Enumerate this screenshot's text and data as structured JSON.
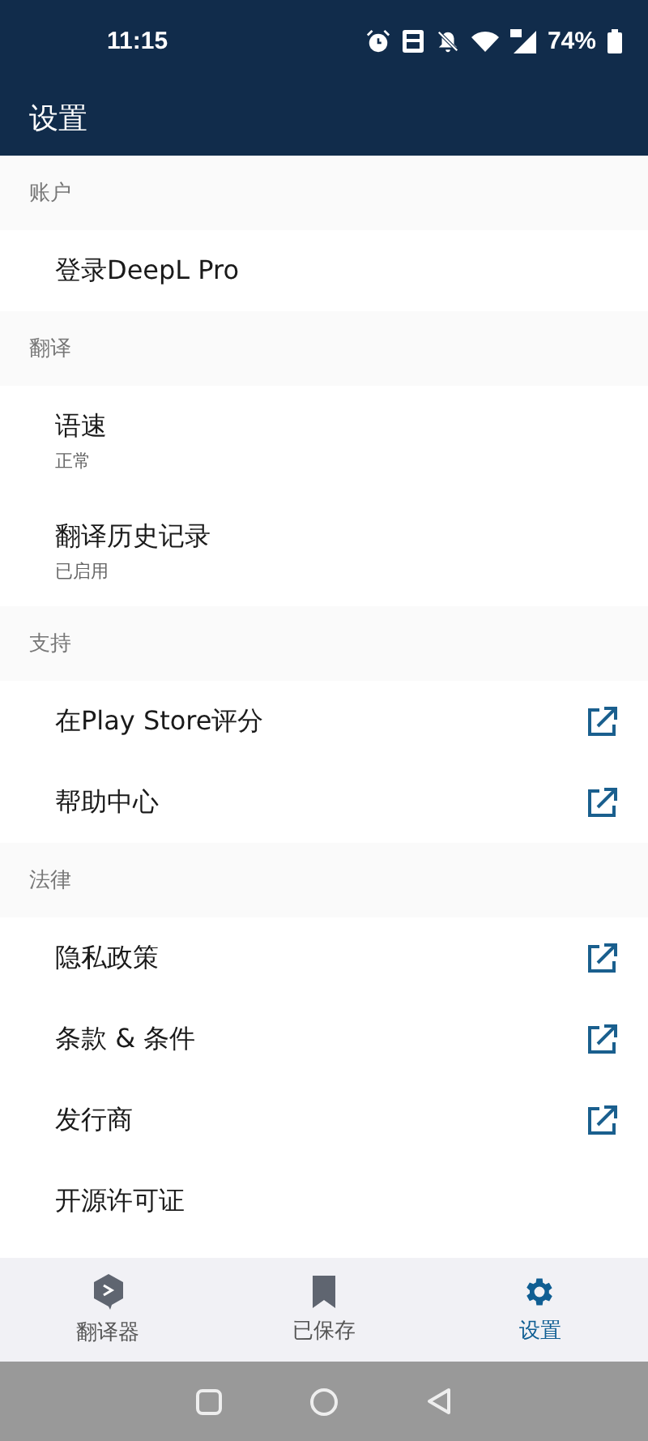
{
  "status_bar": {
    "time": "11:15",
    "battery": "74%"
  },
  "header": {
    "title": "设置"
  },
  "sections": [
    {
      "title": "账户",
      "items": [
        {
          "title": "登录DeepL Pro",
          "external": false
        }
      ]
    },
    {
      "title": "翻译",
      "items": [
        {
          "title": "语速",
          "subtitle": "正常",
          "external": false
        },
        {
          "title": "翻译历史记录",
          "subtitle": "已启用",
          "external": false
        }
      ]
    },
    {
      "title": "支持",
      "items": [
        {
          "title": "在Play Store评分",
          "external": true
        },
        {
          "title": "帮助中心",
          "external": true
        }
      ]
    },
    {
      "title": "法律",
      "items": [
        {
          "title": "隐私政策",
          "external": true
        },
        {
          "title": "条款 & 条件",
          "external": true
        },
        {
          "title": "发行商",
          "external": true
        },
        {
          "title": "开源许可证",
          "external": false
        }
      ]
    }
  ],
  "bottom_nav": [
    {
      "label": "翻译器",
      "kind": "translator",
      "selected": false
    },
    {
      "label": "已保存",
      "kind": "saved",
      "selected": false
    },
    {
      "label": "设置",
      "kind": "settings",
      "selected": true
    }
  ]
}
